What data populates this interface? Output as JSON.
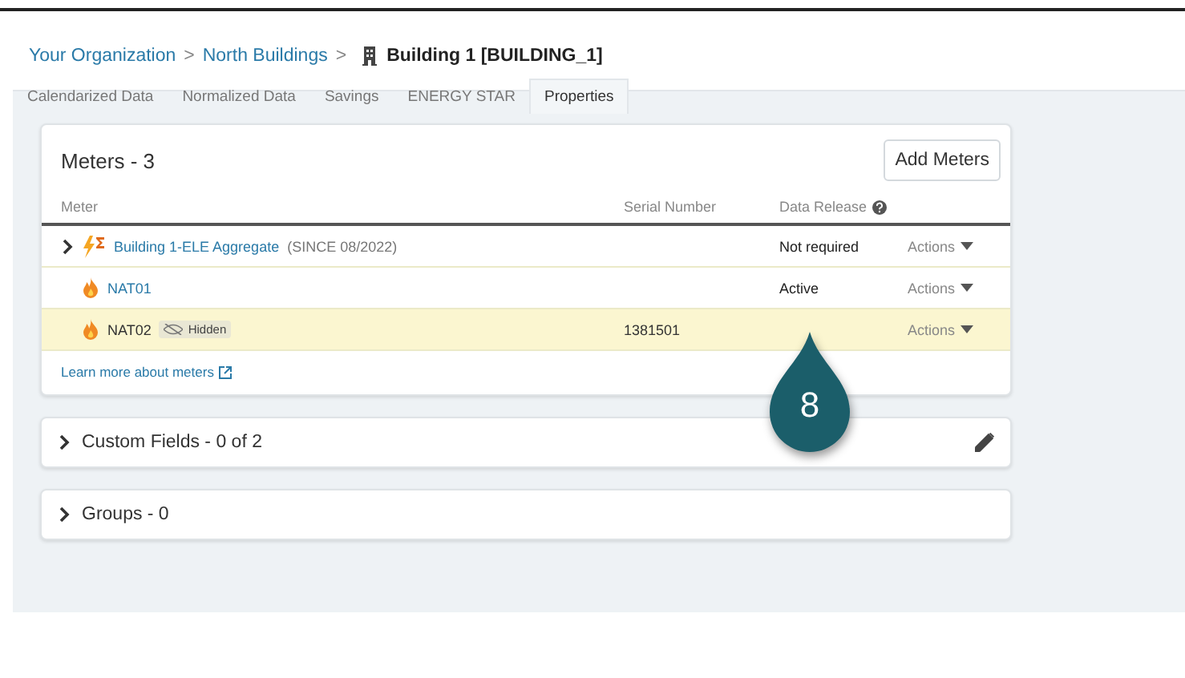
{
  "breadcrumb": {
    "items": [
      "Your Organization",
      "North Buildings"
    ],
    "separator": ">",
    "current": "Building 1 [BUILDING_1]"
  },
  "tabs": [
    {
      "label": "Calendarized Data",
      "selected": false
    },
    {
      "label": "Normalized Data",
      "selected": false
    },
    {
      "label": "Savings",
      "selected": false
    },
    {
      "label": "ENERGY STAR",
      "selected": false
    },
    {
      "label": "Properties",
      "selected": true
    }
  ],
  "meters": {
    "title": "Meters - 3",
    "add_button": "Add Meters",
    "columns": [
      "Meter",
      "Serial Number",
      "Data Release"
    ],
    "rows": [
      {
        "kind": "electric",
        "expandable": true,
        "name": "Building 1-ELE Aggregate",
        "note": "(SINCE 08/2022)",
        "hidden_badge": null,
        "serial": "",
        "release": "Not required",
        "actions": "Actions",
        "highlighted": false
      },
      {
        "kind": "gas",
        "expandable": false,
        "name": "NAT01",
        "note": "",
        "hidden_badge": null,
        "serial": "",
        "release": "Active",
        "actions": "Actions",
        "highlighted": false
      },
      {
        "kind": "gas",
        "expandable": false,
        "name": "NAT02",
        "note": "",
        "hidden_badge": "Hidden",
        "serial": "1381501",
        "release": "",
        "actions": "Actions",
        "highlighted": true
      }
    ],
    "learn_more": "Learn more about meters"
  },
  "sections": [
    {
      "title": "Custom Fields - 0 of 2",
      "editable": true
    },
    {
      "title": "Groups - 0",
      "editable": false
    }
  ],
  "callout": {
    "number": "8"
  }
}
